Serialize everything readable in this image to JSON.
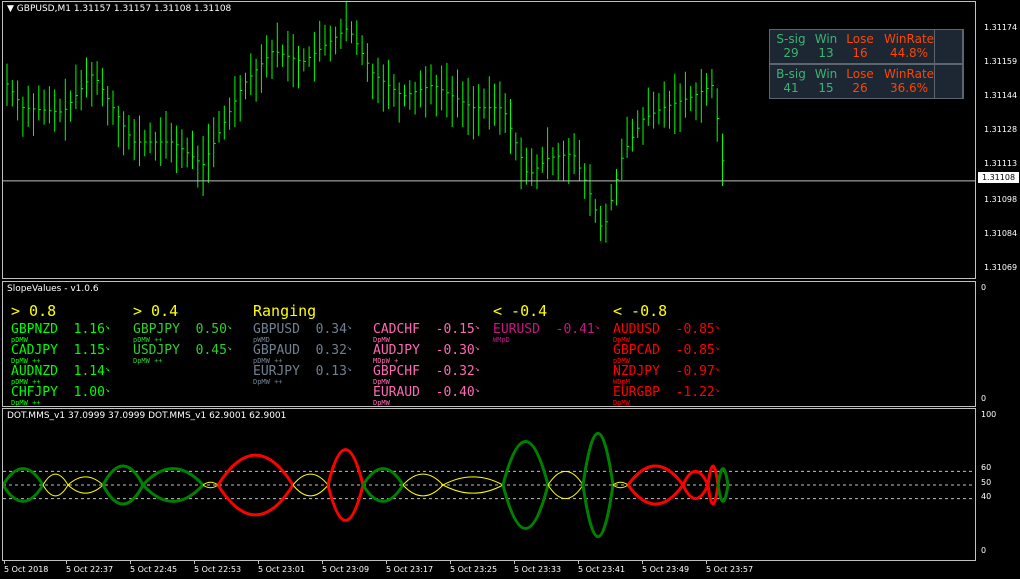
{
  "main_chart": {
    "title": "GBPUSD,M1  1.31157 1.31157 1.31108 1.31108",
    "price_ticks": [
      "1.31174",
      "1.31159",
      "1.31144",
      "1.31128",
      "1.31113",
      "1.31098",
      "1.31084",
      "1.31069"
    ],
    "current_price": "1.31108",
    "stats": {
      "sell": {
        "label": "S-sig",
        "signals": "29",
        "win": "13",
        "lose": "16",
        "winrate": "44.8%"
      },
      "buy": {
        "label": "B-sig",
        "signals": "41",
        "win": "15",
        "lose": "26",
        "winrate": "36.6%"
      },
      "headers": {
        "win": "Win",
        "lose": "Lose",
        "winrate": "WinRate"
      }
    },
    "colors": {
      "bars": "#00ff00",
      "sell_label": "#3cb371",
      "buy_label": "#3cb371",
      "lose": "#ff4500"
    }
  },
  "slope_panel": {
    "title": "SlopeValues - v1.0.6",
    "scale_top": "0",
    "scale_bottom": "0",
    "columns": [
      {
        "header": "> 0.8",
        "color": "#00ff00",
        "items": [
          {
            "pair": "GBPNZD",
            "value": "1.16",
            "arrow": "↘",
            "sub": "pDMW"
          },
          {
            "pair": "CADJPY",
            "value": "1.15",
            "arrow": "↘",
            "sub": "DpMW ++"
          },
          {
            "pair": "AUDNZD",
            "value": "1.14",
            "arrow": "↘",
            "sub": "pDMW ++"
          },
          {
            "pair": "CHFJPY",
            "value": "1.00",
            "arrow": "↘",
            "sub": "DpMW ++"
          }
        ]
      },
      {
        "header": "> 0.4",
        "color": "#32cd32",
        "items": [
          {
            "pair": "GBPJPY",
            "value": "0.50",
            "arrow": "↘",
            "sub": "pDMW ++"
          },
          {
            "pair": "USDJPY",
            "value": "0.45",
            "arrow": "↘",
            "sub": "DpMW ++"
          }
        ]
      },
      {
        "header": "Ranging",
        "color": "#708090",
        "items": [
          {
            "pair": "GBPUSD",
            "value": "0.34",
            "arrow": "↘",
            "sub": "pWMD"
          },
          {
            "pair": "GBPAUD",
            "value": "0.32",
            "arrow": "↘",
            "sub": "pDMW ++"
          },
          {
            "pair": "EURJPY",
            "value": "0.13",
            "arrow": "↘",
            "sub": "DpMW ++"
          }
        ]
      },
      {
        "header": "",
        "color": "#ff69b4",
        "items": [
          {
            "pair": "CADCHF",
            "value": "-0.15",
            "arrow": "↘",
            "sub": "DpMW"
          },
          {
            "pair": "AUDJPY",
            "value": "-0.30",
            "arrow": "↘",
            "sub": "MDpW +"
          },
          {
            "pair": "GBPCHF",
            "value": "-0.32",
            "arrow": "↘",
            "sub": "DpMW"
          },
          {
            "pair": "EURAUD",
            "value": "-0.40",
            "arrow": "↘",
            "sub": "DpMW"
          }
        ]
      },
      {
        "header": "< -0.4",
        "color": "#c71585",
        "items": [
          {
            "pair": "EURUSD",
            "value": "-0.41",
            "arrow": "↘",
            "sub": "WMpD"
          }
        ]
      },
      {
        "header": "< -0.8",
        "color": "#ff0000",
        "items": [
          {
            "pair": "AUDUSD",
            "value": "-0.85",
            "arrow": "↘",
            "sub": "DpMW"
          },
          {
            "pair": "GBPCAD",
            "value": "-0.85",
            "arrow": "↘",
            "sub": "pDMW"
          },
          {
            "pair": "NZDJPY",
            "value": "-0.97",
            "arrow": "↘",
            "sub": "WDpM"
          },
          {
            "pair": "EURGBP",
            "value": "-1.22",
            "arrow": "↘",
            "sub": "DpMW"
          }
        ]
      }
    ]
  },
  "mms_panel": {
    "title": "DOT.MMS_v1 37.0999 37.0999  DOT.MMS_v1 62.9001 62.9001",
    "levels": [
      "100",
      "60",
      "50",
      "40",
      "0"
    ],
    "colors": {
      "up": "#008000",
      "down": "#ff0000",
      "neutral": "#ffff00"
    }
  },
  "time_axis": [
    "5 Oct 2018",
    "5 Oct 22:37",
    "5 Oct 22:45",
    "5 Oct 22:53",
    "5 Oct 23:01",
    "5 Oct 23:09",
    "5 Oct 23:17",
    "5 Oct 23:25",
    "5 Oct 23:33",
    "5 Oct 23:41",
    "5 Oct 23:49",
    "5 Oct 23:57"
  ]
}
